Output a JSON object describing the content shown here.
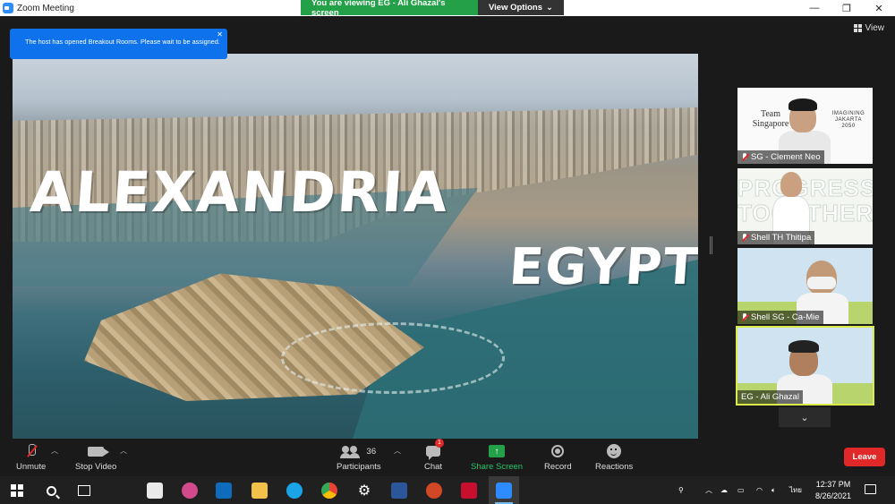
{
  "window": {
    "title": "Zoom Meeting",
    "controls": [
      "—",
      "❐",
      "✕"
    ]
  },
  "banner": {
    "viewing_text": "You are viewing EG - Ali Ghazal's screen",
    "view_options": "View Options"
  },
  "notice": {
    "text": "The host has opened Breakout Rooms. Please wait to be assigned."
  },
  "view_button": {
    "label": "View"
  },
  "shared_screen": {
    "word1": "ALEXANDRIA",
    "word2": "EGYPT"
  },
  "participants_panel": {
    "tiles": [
      {
        "name": "SG - Clement Neo",
        "muted": true,
        "bg_text_left": "Team Singapore",
        "bg_text_right": "IMAGINING JAKARTA 2050"
      },
      {
        "name": "Shell TH Thitipa",
        "muted": true,
        "bg_text": "PROGRESS TOGETHER"
      },
      {
        "name": "Shell SG - Ca-Mie",
        "muted": true
      },
      {
        "name": "EG - Ali Ghazal",
        "muted": false,
        "active_speaker": true
      }
    ]
  },
  "toolbar": {
    "unmute": "Unmute",
    "stop_video": "Stop Video",
    "participants": "Participants",
    "participants_count": "36",
    "chat": "Chat",
    "chat_badge": "1",
    "share_screen": "Share Screen",
    "record": "Record",
    "reactions": "Reactions",
    "leave": "Leave"
  },
  "taskbar": {
    "time": "12:37 PM",
    "date": "8/26/2021",
    "lang": "ไทย"
  },
  "colors": {
    "zoom_blue": "#0e72ed",
    "share_green": "#24a148",
    "leave_red": "#e02828",
    "active_speaker": "#d9ea4a"
  }
}
